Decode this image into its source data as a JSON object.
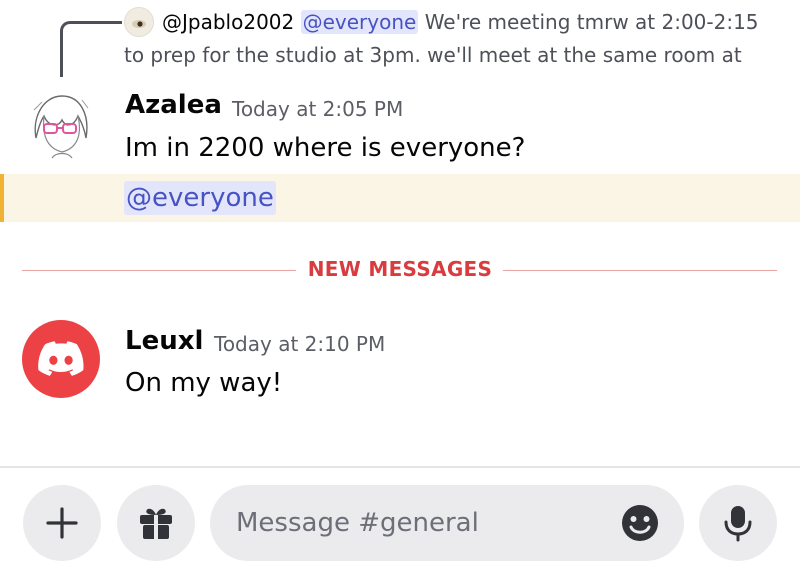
{
  "reply": {
    "username": "@Jpablo2002",
    "mention": "@everyone",
    "text_line1": " We're meeting tmrw at 2:00-2:15",
    "text_line2": "to prep for the studio at 3pm. we'll meet at the same room at"
  },
  "messages": [
    {
      "username": "Azalea",
      "timestamp": "Today at 2:05 PM",
      "text": "Im in 2200 where is everyone?",
      "mention": "@everyone",
      "avatar_icon": "anime-girl-avatar"
    },
    {
      "username": "Leuxl",
      "timestamp": "Today at 2:10 PM",
      "text": "On my way!",
      "avatar_icon": "discord-logo-avatar",
      "avatar_color": "#ed4245"
    }
  ],
  "divider": {
    "label": "NEW MESSAGES",
    "color": "#d83c3e"
  },
  "composer": {
    "placeholder": "Message #general",
    "add_icon": "plus-icon",
    "gift_icon": "gift-icon",
    "emoji_icon": "emoji-icon",
    "mic_icon": "microphone-icon"
  },
  "colors": {
    "mention_text": "#4752c4",
    "mention_bg": "#e3e6fb",
    "highlight_bg": "#fbf5e6",
    "highlight_bar": "#f0b232"
  }
}
